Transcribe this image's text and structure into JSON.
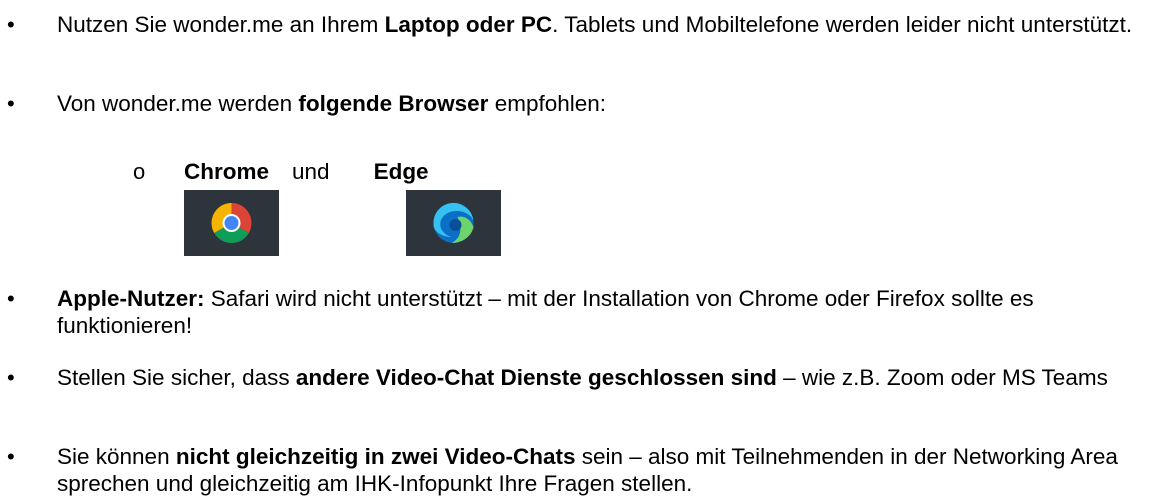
{
  "bullets": [
    {
      "p1": "Nutzen Sie wonder.me an Ihrem ",
      "b1": "Laptop oder PC",
      "p2": ". Tablets und Mobiltelefone werden leider nicht unterstützt."
    },
    {
      "p1": "Von wonder.me werden ",
      "b1": "folgende Browser",
      "p2": " empfohlen:"
    },
    {
      "b1": "Apple-Nutzer:",
      "p2": " Safari wird nicht unterstützt – mit der Installation von Chrome oder Firefox sollte es funktionieren!"
    },
    {
      "p1": "Stellen Sie sicher, dass ",
      "b1": "andere Video-Chat Dienste geschlossen sind",
      "p2": " – wie z.B. Zoom oder MS Teams"
    },
    {
      "p1": "Sie können ",
      "b1": "nicht gleichzeitig in zwei Video-Chats",
      "p2": " sein – also mit Teilnehmenden in der Networking Area sprechen und gleichzeitig am IHK-Infopunkt Ihre Fragen stellen."
    }
  ],
  "browsers": {
    "first": "Chrome",
    "joiner": "und",
    "second": "Edge"
  },
  "icons": [
    "chrome-logo-icon",
    "edge-logo-icon"
  ],
  "colors": {
    "logo_bg": "#2e343b",
    "text": "#000000"
  }
}
